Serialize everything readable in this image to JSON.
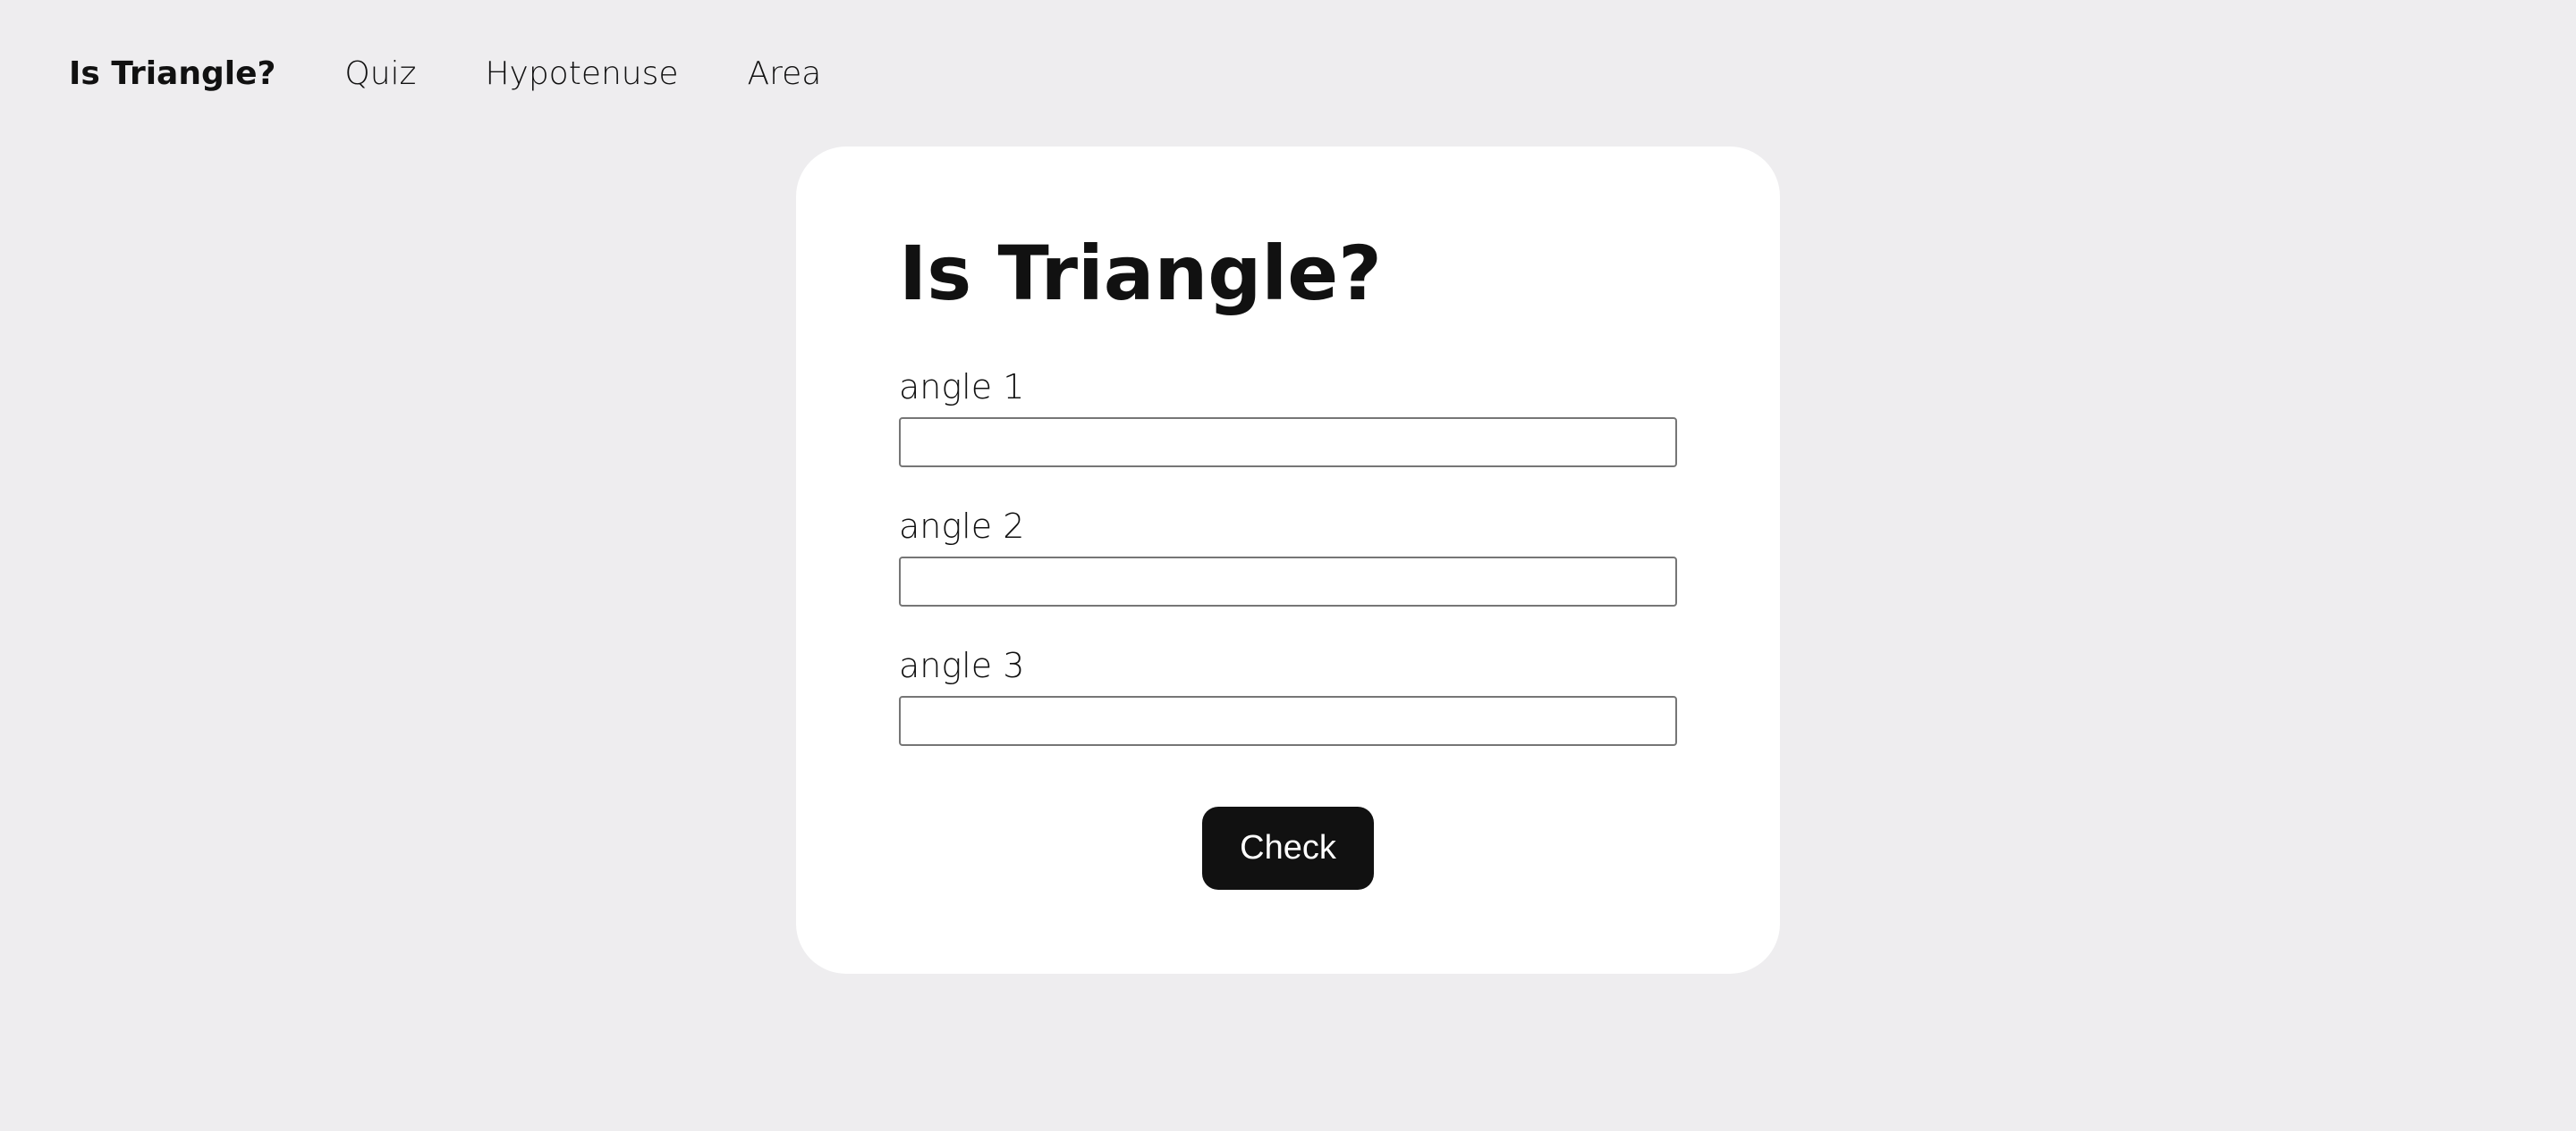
{
  "nav": {
    "items": [
      {
        "label": "Is Triangle?",
        "active": true
      },
      {
        "label": "Quiz",
        "active": false
      },
      {
        "label": "Hypotenuse",
        "active": false
      },
      {
        "label": "Area",
        "active": false
      }
    ]
  },
  "form": {
    "title": "Is Triangle?",
    "fields": [
      {
        "label": "angle 1",
        "value": ""
      },
      {
        "label": "angle 2",
        "value": ""
      },
      {
        "label": "angle 3",
        "value": ""
      }
    ],
    "submit_label": "Check"
  },
  "colors": {
    "page_background": "#eeedef",
    "card_background": "#ffffff",
    "text": "#111111",
    "button_background": "#111111",
    "button_text": "#ffffff"
  }
}
